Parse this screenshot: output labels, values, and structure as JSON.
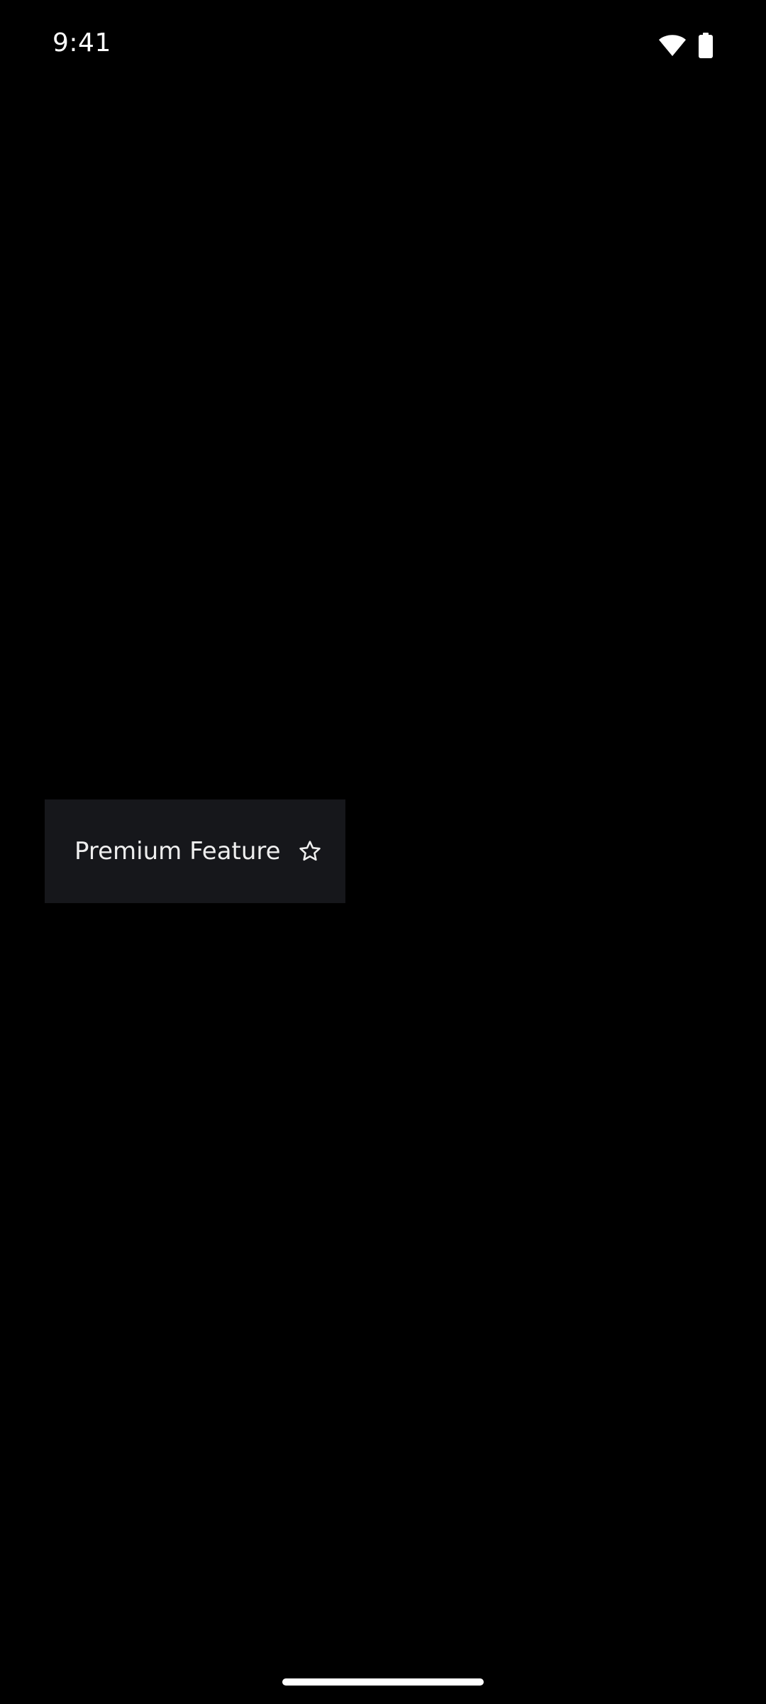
{
  "status_bar": {
    "time": "9:41",
    "icons": [
      "wifi-icon",
      "battery-icon"
    ]
  },
  "popup_menu": {
    "items": [
      {
        "label": "Premium Feature",
        "icon": "star-outline-icon"
      }
    ]
  },
  "colors": {
    "background": "#000000",
    "popup_background": "#16171b",
    "text": "#eeeeee"
  }
}
